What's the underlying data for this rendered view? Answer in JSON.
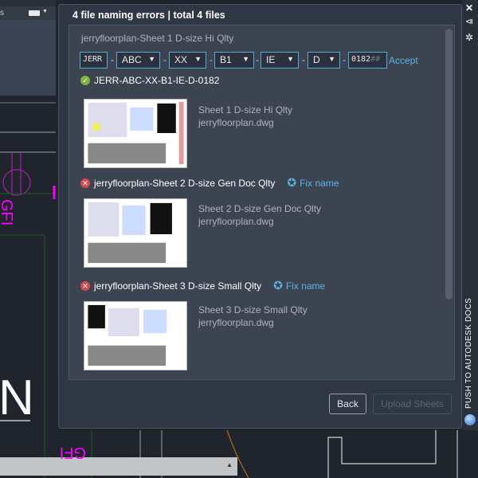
{
  "left_panel": {
    "header_text": "s"
  },
  "dialog": {
    "title": "4 file naming errors | total 4 files",
    "current": {
      "original_name": "jerryfloorplan-Sheet 1 D-size Hi Qlty",
      "fields": {
        "project": "JERR",
        "originator": "ABC",
        "volume": "XX",
        "level": "B1",
        "type": "IE",
        "role": "D",
        "number": "0182",
        "number_placeholder": "##"
      },
      "separator": "-",
      "accept_label": "Accept",
      "result_name": "JERR-ABC-XX-B1-IE-D-0182",
      "sheet": "Sheet 1 D-size Hi Qlty",
      "file": "jerryfloorplan.dwg"
    },
    "errors": [
      {
        "name": "jerryfloorplan-Sheet 2 D-size Gen Doc Qlty",
        "fix_label": "Fix name",
        "sheet": "Sheet 2 D-size Gen Doc Qlty",
        "file": "jerryfloorplan.dwg"
      },
      {
        "name": "jerryfloorplan-Sheet 3 D-size Small Qlty",
        "fix_label": "Fix name",
        "sheet": "Sheet 3 D-size Small Qlty",
        "file": "jerryfloorplan.dwg"
      }
    ],
    "back_label": "Back",
    "upload_label": "Upload Sheets"
  },
  "sidebar": {
    "title": "PUSH TO AUTODESK DOCS",
    "icons": [
      "close-icon",
      "collapse-icon",
      "gear-icon",
      "globe-icon"
    ]
  },
  "cad": {
    "labels": [
      "GFI",
      "N",
      "GFI"
    ]
  },
  "colors": {
    "accent": "#52a9d8",
    "error": "#d44a4a",
    "success": "#7cb342",
    "magenta": "#ff00ff"
  }
}
